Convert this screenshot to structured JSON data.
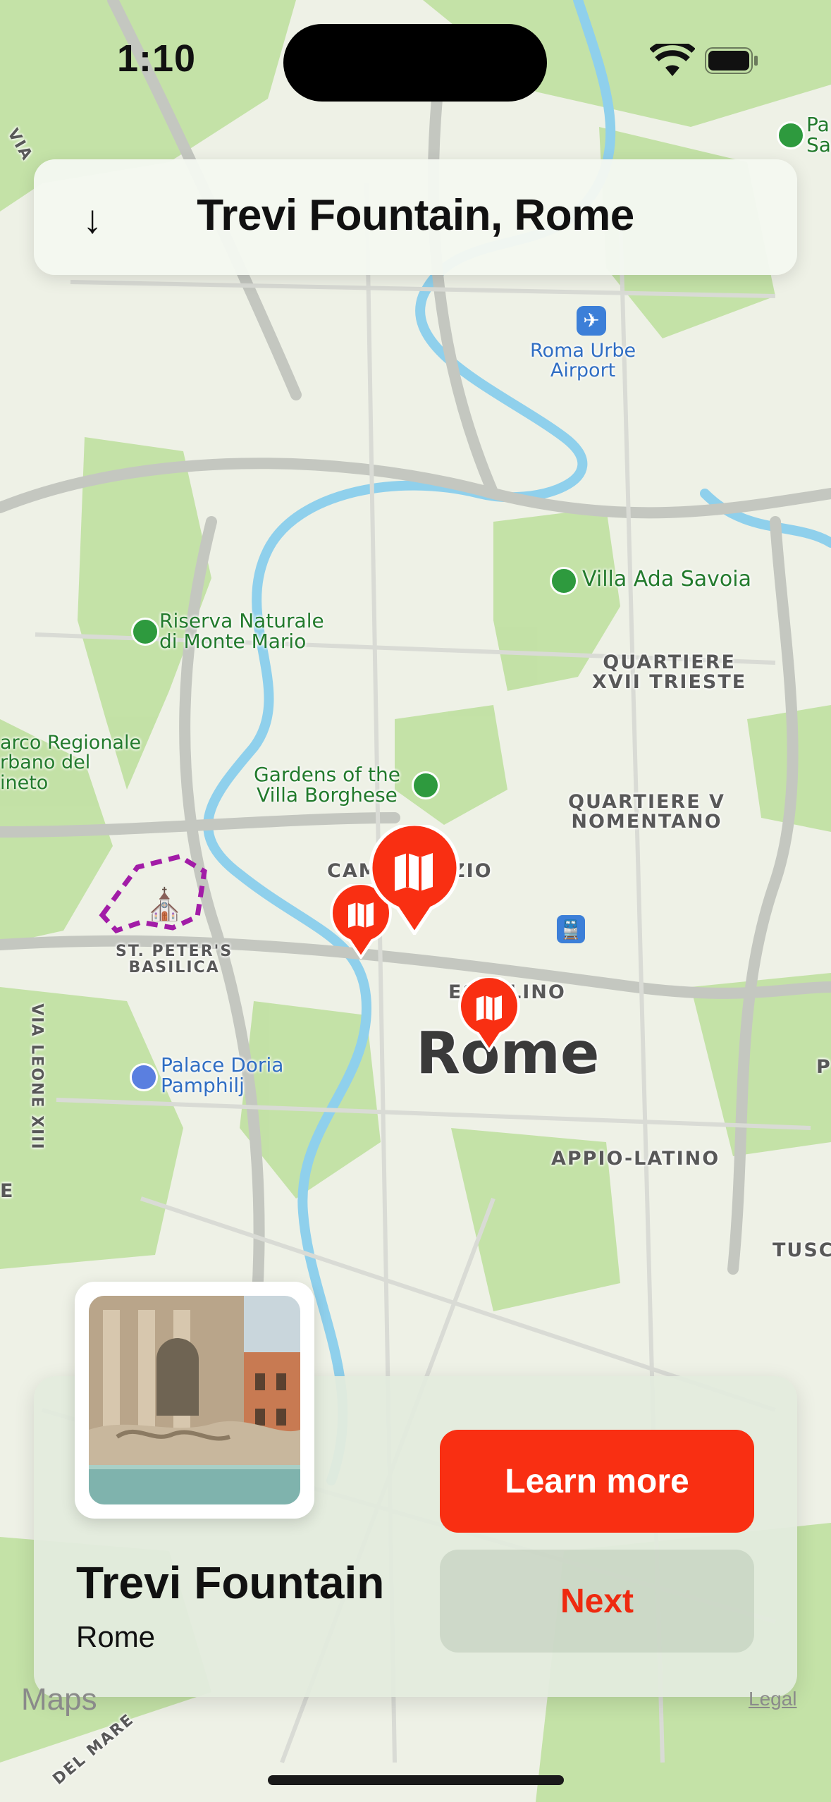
{
  "status_bar": {
    "time": "1:10"
  },
  "search": {
    "title": "Trevi Fountain, Rome",
    "back_icon": "arrow-down-icon"
  },
  "map_labels": {
    "airport": "Roma Urbe\nAirport",
    "villa_ada": "Villa Ada Savoia",
    "riserva": "Riserva Naturale\ndi Monte Mario",
    "quartiere_xvii": "QUARTIERE\nXVII TRIESTE",
    "parco": "arco Regionale\nrbano del\nineto",
    "gardens": "Gardens of the\nVilla Borghese",
    "quartiere_v": "QUARTIERE V\nNOMENTANO",
    "campo": "CAM",
    "campo_tail": "ZIO",
    "st_peters": "ST. PETER'S\nBASILICA",
    "esquilino": "ES",
    "esquilino_tail": "LINO",
    "rome": "Rome",
    "palace": "Palace Doria\nPamphilj",
    "appio": "APPIO-LATINO",
    "tusco": "TUSCO",
    "via_leone": "VIA LEONE XIII",
    "via_top": "VIA",
    "top_right": "Pa\nSa",
    "del_mare": "DEL MARE",
    "edge_p": "P",
    "edge_e": "E"
  },
  "card": {
    "title": "Trevi Fountain",
    "subtitle": "Rome",
    "learn_more": "Learn more",
    "next": "Next"
  },
  "footer": {
    "maps": "Maps",
    "legal": "Legal"
  },
  "colors": {
    "accent": "#f92f12",
    "park": "#b9dc98",
    "water": "#8fd0ec",
    "road": "#bdbdbd"
  }
}
